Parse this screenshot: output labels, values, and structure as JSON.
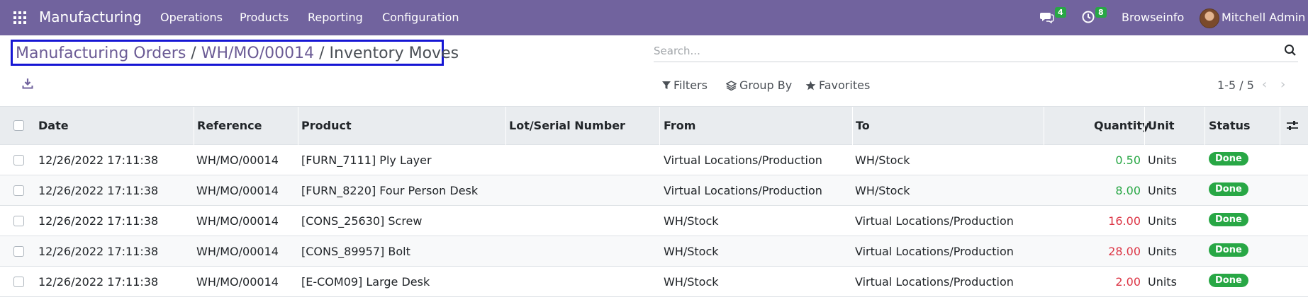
{
  "navbar": {
    "app_name": "Manufacturing",
    "menu": [
      "Operations",
      "Products",
      "Reporting",
      "Configuration"
    ],
    "messages_count": "4",
    "activities_count": "8",
    "company": "Browseinfo",
    "user": "Mitchell Admin"
  },
  "breadcrumb": {
    "parts": [
      "Manufacturing Orders",
      "WH/MO/00014",
      "Inventory Moves"
    ],
    "separator": "/"
  },
  "search": {
    "placeholder": "Search..."
  },
  "filters": {
    "filters_label": "Filters",
    "group_by_label": "Group By",
    "favorites_label": "Favorites"
  },
  "pager": {
    "value": "1-5 / 5"
  },
  "table": {
    "headers": {
      "date": "Date",
      "reference": "Reference",
      "product": "Product",
      "lot": "Lot/Serial Number",
      "from": "From",
      "to": "To",
      "quantity": "Quantity",
      "unit": "Unit",
      "status": "Status"
    },
    "rows": [
      {
        "date": "12/26/2022 17:11:38",
        "reference": "WH/MO/00014",
        "product": "[FURN_7111] Ply Layer",
        "lot": "",
        "from": "Virtual Locations/Production",
        "to": "WH/Stock",
        "quantity": "0.50",
        "unit": "Units",
        "status": "Done"
      },
      {
        "date": "12/26/2022 17:11:38",
        "reference": "WH/MO/00014",
        "product": "[FURN_8220] Four Person Desk",
        "lot": "",
        "from": "Virtual Locations/Production",
        "to": "WH/Stock",
        "quantity": "8.00",
        "unit": "Units",
        "status": "Done"
      },
      {
        "date": "12/26/2022 17:11:38",
        "reference": "WH/MO/00014",
        "product": "[CONS_25630] Screw",
        "lot": "",
        "from": "WH/Stock",
        "to": "Virtual Locations/Production",
        "quantity": "16.00",
        "unit": "Units",
        "status": "Done"
      },
      {
        "date": "12/26/2022 17:11:38",
        "reference": "WH/MO/00014",
        "product": "[CONS_89957] Bolt",
        "lot": "",
        "from": "WH/Stock",
        "to": "Virtual Locations/Production",
        "quantity": "28.00",
        "unit": "Units",
        "status": "Done"
      },
      {
        "date": "12/26/2022 17:11:38",
        "reference": "WH/MO/00014",
        "product": "[E-COM09] Large Desk",
        "lot": "",
        "from": "WH/Stock",
        "to": "Virtual Locations/Production",
        "quantity": "2.00",
        "unit": "Units",
        "status": "Done"
      }
    ]
  },
  "colors": {
    "navbar": "#71639e",
    "done_badge": "#28a745",
    "qty_in": "#28a745",
    "qty_out": "#dc3545",
    "highlight_border": "#1616d4"
  }
}
